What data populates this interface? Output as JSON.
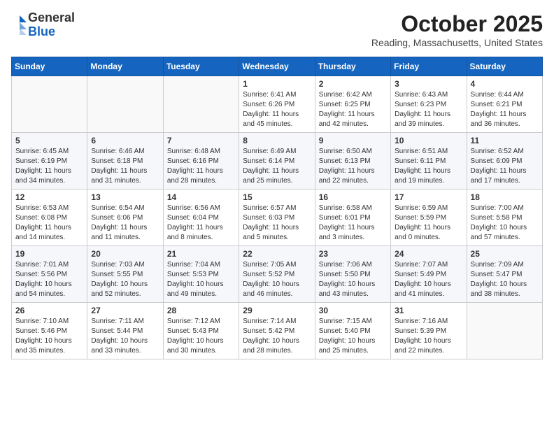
{
  "header": {
    "logo_general": "General",
    "logo_blue": "Blue",
    "month_title": "October 2025",
    "location": "Reading, Massachusetts, United States"
  },
  "weekdays": [
    "Sunday",
    "Monday",
    "Tuesday",
    "Wednesday",
    "Thursday",
    "Friday",
    "Saturday"
  ],
  "weeks": [
    [
      {
        "day": "",
        "info": ""
      },
      {
        "day": "",
        "info": ""
      },
      {
        "day": "",
        "info": ""
      },
      {
        "day": "1",
        "info": "Sunrise: 6:41 AM\nSunset: 6:26 PM\nDaylight: 11 hours\nand 45 minutes."
      },
      {
        "day": "2",
        "info": "Sunrise: 6:42 AM\nSunset: 6:25 PM\nDaylight: 11 hours\nand 42 minutes."
      },
      {
        "day": "3",
        "info": "Sunrise: 6:43 AM\nSunset: 6:23 PM\nDaylight: 11 hours\nand 39 minutes."
      },
      {
        "day": "4",
        "info": "Sunrise: 6:44 AM\nSunset: 6:21 PM\nDaylight: 11 hours\nand 36 minutes."
      }
    ],
    [
      {
        "day": "5",
        "info": "Sunrise: 6:45 AM\nSunset: 6:19 PM\nDaylight: 11 hours\nand 34 minutes."
      },
      {
        "day": "6",
        "info": "Sunrise: 6:46 AM\nSunset: 6:18 PM\nDaylight: 11 hours\nand 31 minutes."
      },
      {
        "day": "7",
        "info": "Sunrise: 6:48 AM\nSunset: 6:16 PM\nDaylight: 11 hours\nand 28 minutes."
      },
      {
        "day": "8",
        "info": "Sunrise: 6:49 AM\nSunset: 6:14 PM\nDaylight: 11 hours\nand 25 minutes."
      },
      {
        "day": "9",
        "info": "Sunrise: 6:50 AM\nSunset: 6:13 PM\nDaylight: 11 hours\nand 22 minutes."
      },
      {
        "day": "10",
        "info": "Sunrise: 6:51 AM\nSunset: 6:11 PM\nDaylight: 11 hours\nand 19 minutes."
      },
      {
        "day": "11",
        "info": "Sunrise: 6:52 AM\nSunset: 6:09 PM\nDaylight: 11 hours\nand 17 minutes."
      }
    ],
    [
      {
        "day": "12",
        "info": "Sunrise: 6:53 AM\nSunset: 6:08 PM\nDaylight: 11 hours\nand 14 minutes."
      },
      {
        "day": "13",
        "info": "Sunrise: 6:54 AM\nSunset: 6:06 PM\nDaylight: 11 hours\nand 11 minutes."
      },
      {
        "day": "14",
        "info": "Sunrise: 6:56 AM\nSunset: 6:04 PM\nDaylight: 11 hours\nand 8 minutes."
      },
      {
        "day": "15",
        "info": "Sunrise: 6:57 AM\nSunset: 6:03 PM\nDaylight: 11 hours\nand 5 minutes."
      },
      {
        "day": "16",
        "info": "Sunrise: 6:58 AM\nSunset: 6:01 PM\nDaylight: 11 hours\nand 3 minutes."
      },
      {
        "day": "17",
        "info": "Sunrise: 6:59 AM\nSunset: 5:59 PM\nDaylight: 11 hours\nand 0 minutes."
      },
      {
        "day": "18",
        "info": "Sunrise: 7:00 AM\nSunset: 5:58 PM\nDaylight: 10 hours\nand 57 minutes."
      }
    ],
    [
      {
        "day": "19",
        "info": "Sunrise: 7:01 AM\nSunset: 5:56 PM\nDaylight: 10 hours\nand 54 minutes."
      },
      {
        "day": "20",
        "info": "Sunrise: 7:03 AM\nSunset: 5:55 PM\nDaylight: 10 hours\nand 52 minutes."
      },
      {
        "day": "21",
        "info": "Sunrise: 7:04 AM\nSunset: 5:53 PM\nDaylight: 10 hours\nand 49 minutes."
      },
      {
        "day": "22",
        "info": "Sunrise: 7:05 AM\nSunset: 5:52 PM\nDaylight: 10 hours\nand 46 minutes."
      },
      {
        "day": "23",
        "info": "Sunrise: 7:06 AM\nSunset: 5:50 PM\nDaylight: 10 hours\nand 43 minutes."
      },
      {
        "day": "24",
        "info": "Sunrise: 7:07 AM\nSunset: 5:49 PM\nDaylight: 10 hours\nand 41 minutes."
      },
      {
        "day": "25",
        "info": "Sunrise: 7:09 AM\nSunset: 5:47 PM\nDaylight: 10 hours\nand 38 minutes."
      }
    ],
    [
      {
        "day": "26",
        "info": "Sunrise: 7:10 AM\nSunset: 5:46 PM\nDaylight: 10 hours\nand 35 minutes."
      },
      {
        "day": "27",
        "info": "Sunrise: 7:11 AM\nSunset: 5:44 PM\nDaylight: 10 hours\nand 33 minutes."
      },
      {
        "day": "28",
        "info": "Sunrise: 7:12 AM\nSunset: 5:43 PM\nDaylight: 10 hours\nand 30 minutes."
      },
      {
        "day": "29",
        "info": "Sunrise: 7:14 AM\nSunset: 5:42 PM\nDaylight: 10 hours\nand 28 minutes."
      },
      {
        "day": "30",
        "info": "Sunrise: 7:15 AM\nSunset: 5:40 PM\nDaylight: 10 hours\nand 25 minutes."
      },
      {
        "day": "31",
        "info": "Sunrise: 7:16 AM\nSunset: 5:39 PM\nDaylight: 10 hours\nand 22 minutes."
      },
      {
        "day": "",
        "info": ""
      }
    ]
  ]
}
